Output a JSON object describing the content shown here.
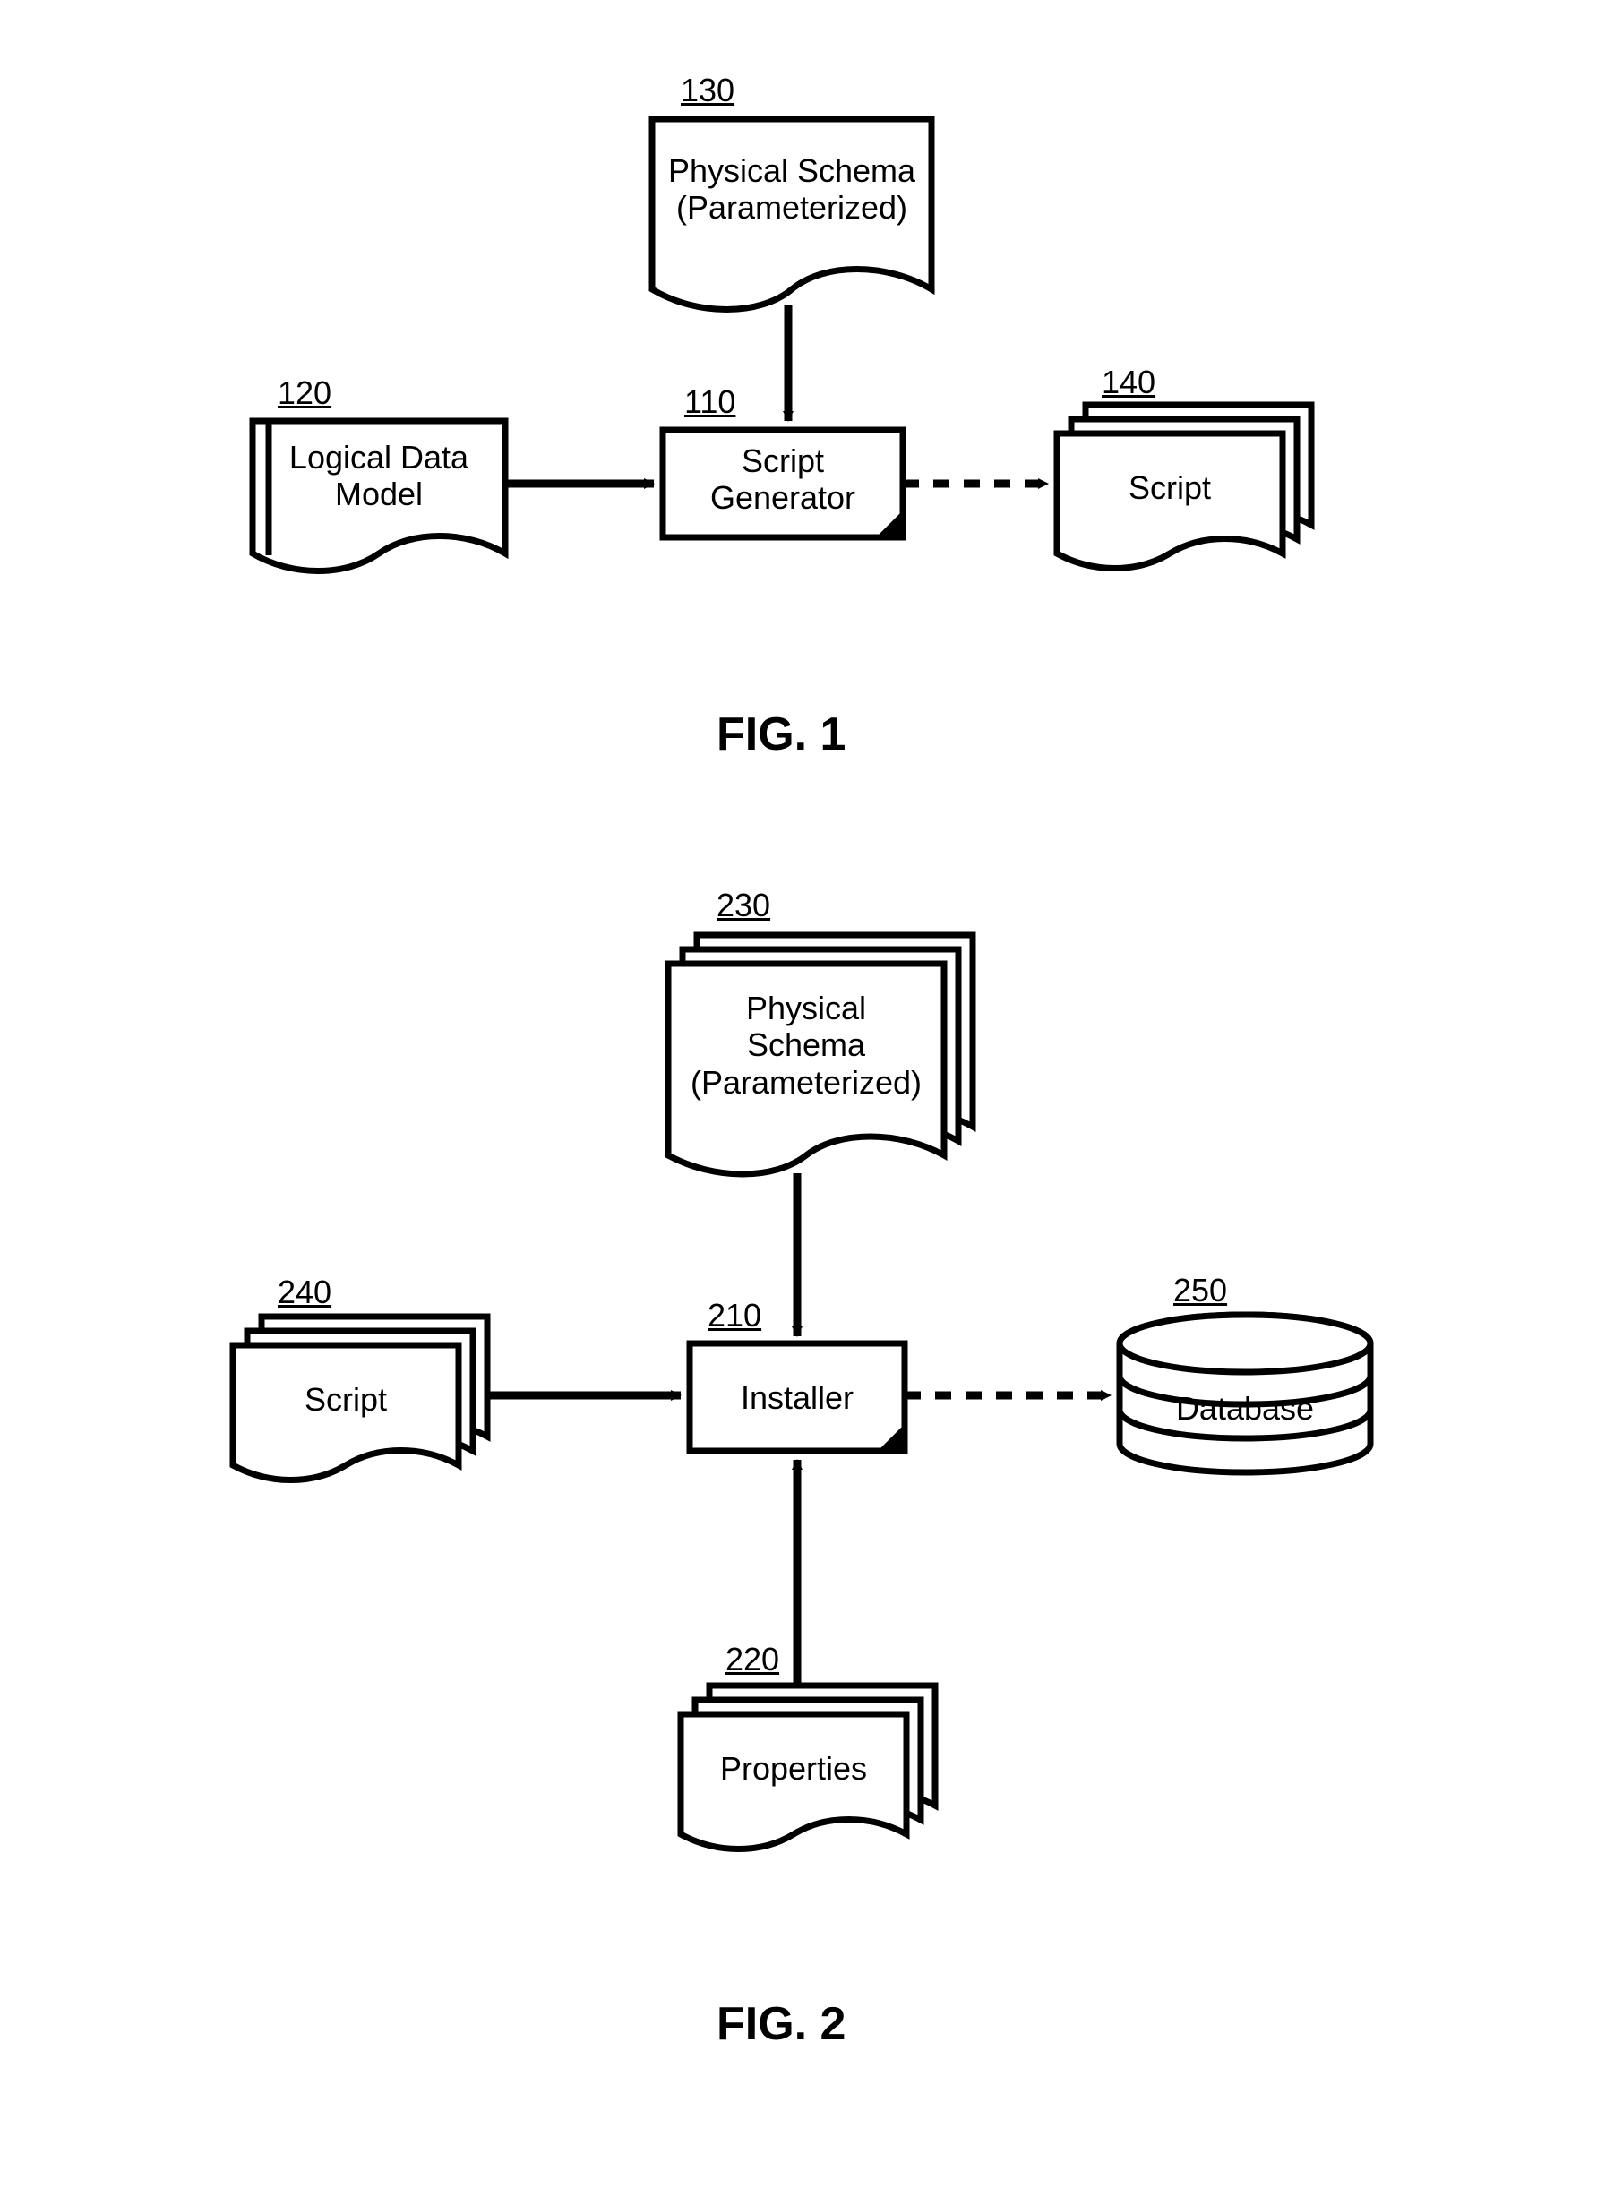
{
  "fig1": {
    "title": "FIG. 1",
    "nodes": {
      "n130": {
        "num": "130",
        "text": "Physical Schema\n(Parameterized)"
      },
      "n120": {
        "num": "120",
        "text": "Logical Data\nModel"
      },
      "n110": {
        "num": "110",
        "text": "Script\nGenerator"
      },
      "n140": {
        "num": "140",
        "text": "Script"
      }
    }
  },
  "fig2": {
    "title": "FIG. 2",
    "nodes": {
      "n230": {
        "num": "230",
        "text": "Physical\nSchema\n(Parameterized)"
      },
      "n240": {
        "num": "240",
        "text": "Script"
      },
      "n210": {
        "num": "210",
        "text": "Installer"
      },
      "n250": {
        "num": "250",
        "text": "Database"
      },
      "n220": {
        "num": "220",
        "text": "Properties"
      }
    }
  }
}
